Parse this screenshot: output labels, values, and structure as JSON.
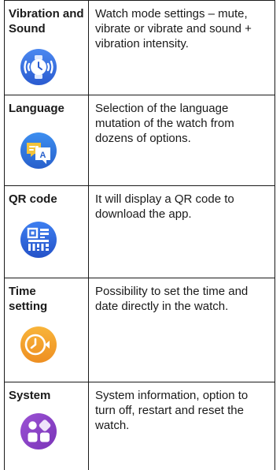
{
  "features": [
    {
      "name": "Vibration and Sound",
      "description": "Watch mode settings – mute, vibrate or vibrate and sound + vibration intensity.",
      "icon": "vibration-watch-icon"
    },
    {
      "name": "Language",
      "description": "Selection of the language mutation of the watch from dozens of options.",
      "icon": "language-translate-icon"
    },
    {
      "name": "QR code",
      "description": "It will display a QR code to download the app.",
      "icon": "qr-code-icon"
    },
    {
      "name": "Time setting",
      "description": "Possibility to set the time and date directly in the watch.",
      "icon": "time-setting-icon"
    },
    {
      "name": "System",
      "description": "System information, option to turn off, restart and reset the watch.",
      "icon": "system-apps-icon"
    }
  ],
  "colors": {
    "vibration": "#3a6fe0",
    "language": "#2e73d8",
    "qr": "#2a5fd6",
    "time": "#f2a42c",
    "system": "#8a45c8"
  }
}
